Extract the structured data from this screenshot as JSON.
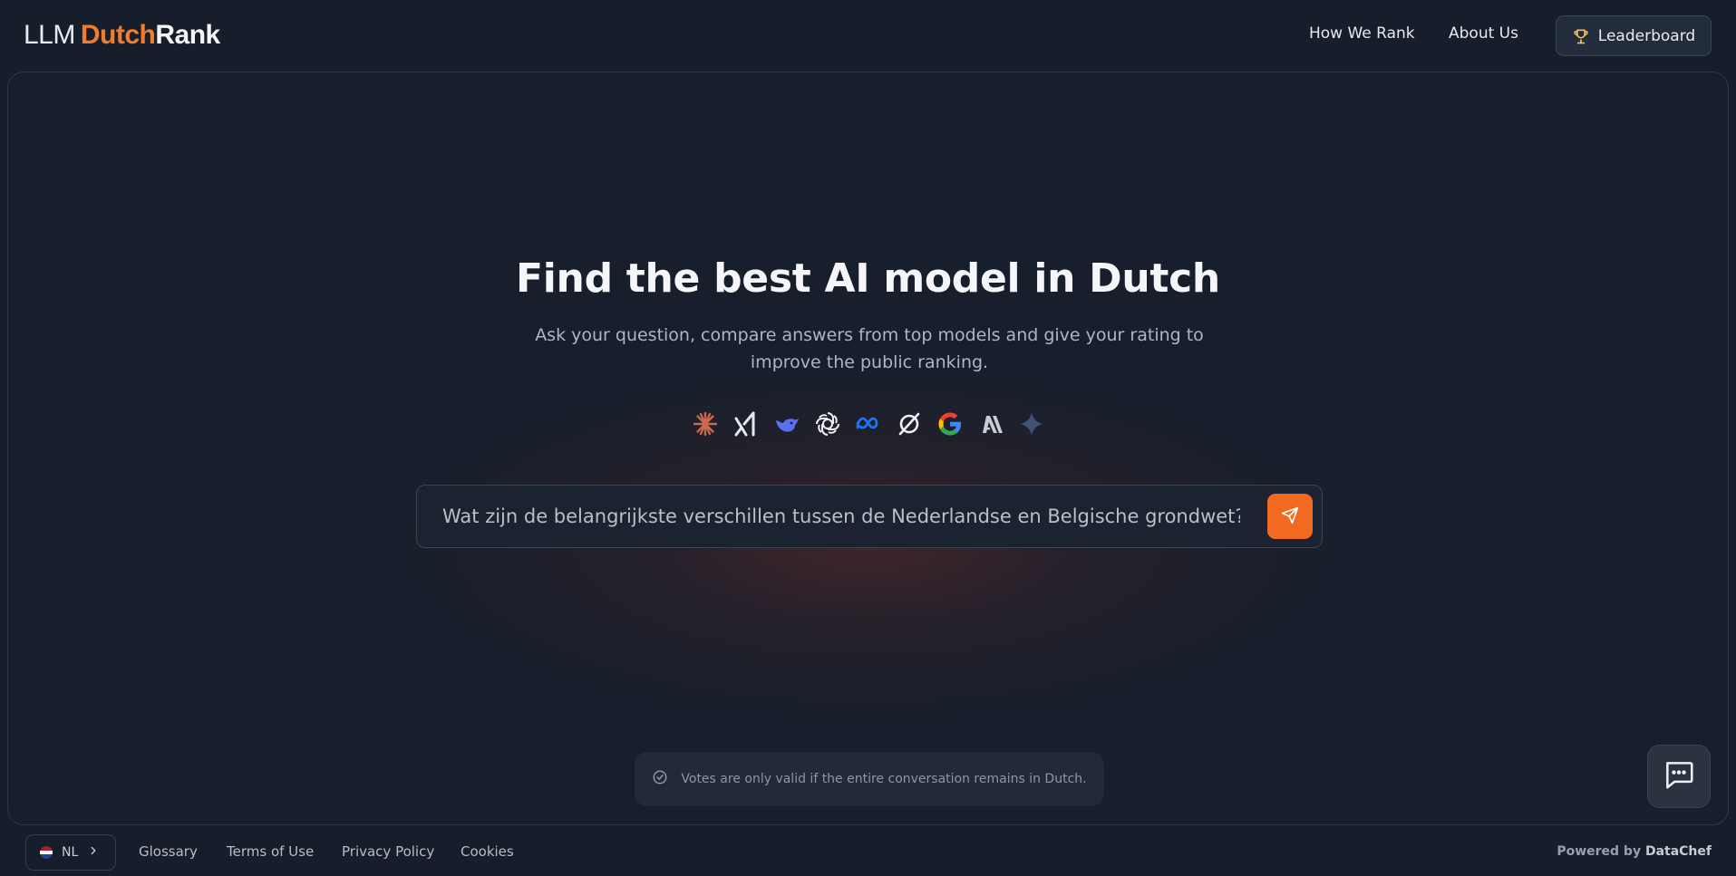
{
  "header": {
    "logo": {
      "part1": "LLM",
      "part2": "Dutch",
      "part3": "Rank"
    },
    "nav": {
      "how_we_rank": "How We Rank",
      "about_us": "About Us"
    },
    "leaderboard_label": "Leaderboard"
  },
  "hero": {
    "title": "Find the best AI model in Dutch",
    "subtitle": "Ask your question, compare answers from top models and give your rating to improve the public ranking.",
    "model_icons": [
      "claude-icon",
      "xai-grok-icon",
      "deepseek-icon",
      "openai-icon",
      "meta-icon",
      "perplexity-icon",
      "google-icon",
      "anthropic-icon",
      "gemini-icon"
    ]
  },
  "prompt": {
    "value": "Wat zijn de belangrijkste verschillen tussen de Nederlandse en Belgische grondwet?",
    "send_icon": "send-icon"
  },
  "notice": {
    "text": "Votes are only valid if the entire conversation remains in Dutch.",
    "icon": "check-circle-icon"
  },
  "footer": {
    "language": "NL",
    "links": {
      "glossary": "Glossary",
      "terms": "Terms of Use",
      "privacy": "Privacy Policy",
      "cookies": "Cookies"
    },
    "powered_prefix": "Powered by",
    "powered_brand": "DataChef"
  },
  "colors": {
    "accent": "#f26a22",
    "logo_accent": "#f07d2b",
    "background": "#161e2b"
  }
}
